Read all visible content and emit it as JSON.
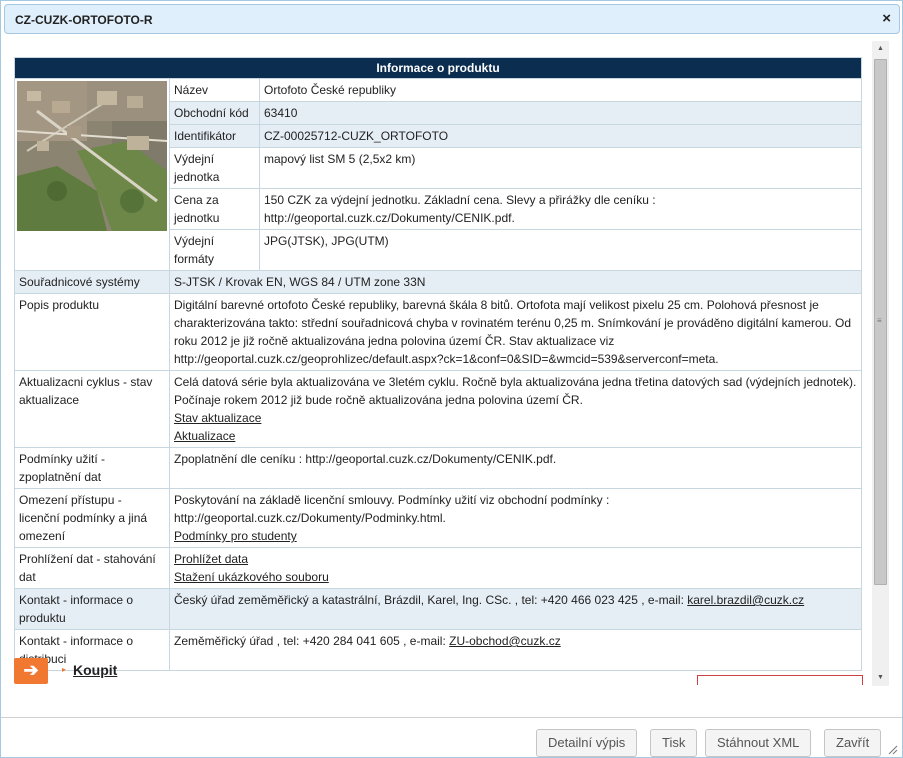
{
  "window": {
    "title": "CZ-CUZK-ORTOFOTO-R",
    "close_icon": "×"
  },
  "table": {
    "header": "Informace o produktu",
    "inner_rows": [
      {
        "label": "Název",
        "value": "Ortofoto České republiky"
      },
      {
        "label": "Obchodní kód",
        "value": "63410"
      },
      {
        "label": "Identifikátor",
        "value": "CZ-00025712-CUZK_ORTOFOTO"
      },
      {
        "label": "Výdejní jednotka",
        "value": "mapový list SM 5 (2,5x2 km)"
      },
      {
        "label": "Cena za jednotku",
        "value": "150 CZK za výdejní jednotku. Základní cena. Slevy a přirážky dle ceníku : http://geoportal.cuzk.cz/Dokumenty/CENIK.pdf."
      },
      {
        "label": "Výdejní formáty",
        "value": "JPG(JTSK), JPG(UTM)"
      }
    ],
    "rows": {
      "crs": {
        "label": "Souřadnicové systémy",
        "value": "S-JTSK / Krovak EN, WGS 84 / UTM zone 33N"
      },
      "desc": {
        "label": "Popis produktu",
        "value": "Digitální barevné ortofoto České republiky, barevná škála 8 bitů. Ortofota mají velikost pixelu 25 cm. Polohová přesnost je charakterizována takto: střední souřadnicová chyba v rovinatém terénu 0,25 m. Snímkování je prováděno digitální kamerou. Od roku 2012 je již ročně aktualizována jedna polovina území ČR. Stav aktualizace viz http://geoportal.cuzk.cz/geoprohlizec/default.aspx?ck=1&conf=0&SID=&wmcid=539&serverconf=meta."
      },
      "update": {
        "label": "Aktualizacni cyklus - stav aktualizace",
        "value": "Celá datová série byla aktualizována ve 3letém cyklu. Ročně byla aktualizována jedna třetina datových sad (výdejních jednotek). Počínaje rokem 2012 již bude ročně aktualizována jedna polovina území ČR.",
        "link1": "Stav aktualizace",
        "link2": "Aktualizace"
      },
      "terms": {
        "label": "Podmínky užití - zpoplatnění dat",
        "value": "Zpoplatnění dle ceníku : http://geoportal.cuzk.cz/Dokumenty/CENIK.pdf."
      },
      "access": {
        "label": "Omezení přístupu - licenční podmínky a jiná omezení",
        "value": "Poskytování na základě licenční smlouvy. Podmínky užití viz obchodní podmínky : http://geoportal.cuzk.cz/Dokumenty/Podminky.html.",
        "link": "Podmínky pro studenty"
      },
      "browse": {
        "label": "Prohlížení dat - stahování dat",
        "link1": "Prohlížet data",
        "link2": "Stažení ukázkového souboru"
      },
      "contact_product": {
        "label": "Kontakt - informace o produktu",
        "value": "Český úřad zeměměřický a katastrální, Brázdil, Karel, Ing. CSc. , tel: +420 466 023 425 , e-mail: ",
        "email": "karel.brazdil@cuzk.cz"
      },
      "contact_dist": {
        "label": "Kontakt - informace o distribuci",
        "value": "Zeměměřický úřad , tel: +420 284 041 605 , e-mail: ",
        "email": "ZU-obchod@cuzk.cz"
      }
    }
  },
  "buy": {
    "arrow_icon": "➔",
    "caret_icon": "▸",
    "label": "Koupit"
  },
  "footer": {
    "buttons": [
      "Detailní výpis",
      "Tisk",
      "Stáhnout XML",
      "Zavřít"
    ]
  },
  "colors": {
    "header_bg": "#0b2d4f",
    "accent": "#f07830",
    "titlebar_bg": "#dfeffc",
    "alt_row": "#e6eef5"
  }
}
